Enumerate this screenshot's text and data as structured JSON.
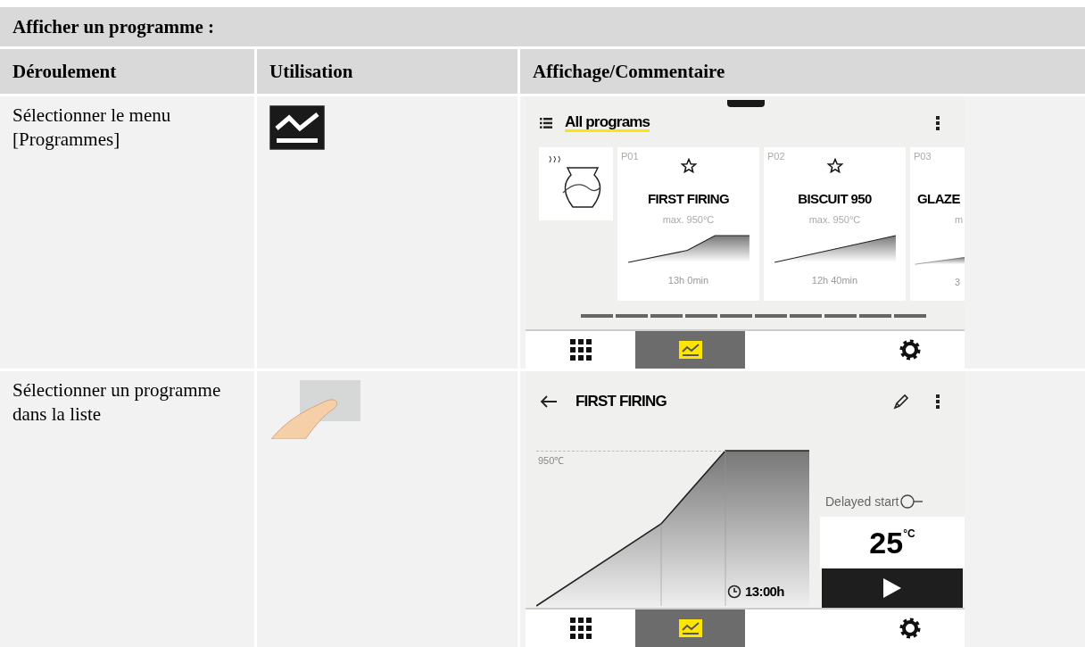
{
  "section_title": "Afficher un programme :",
  "columns": [
    "Déroulement",
    "Utilisation",
    "Affichage/Commentaire"
  ],
  "steps": [
    {
      "text": "Sélectionner le menu [Programmes]",
      "kind": "menu-icon",
      "screen": {
        "kind": "list",
        "title": "All programs",
        "cards": [
          {
            "code": "P01",
            "title": "FIRST FIRING",
            "max": "max. 950°C",
            "duration": "13h 0min"
          },
          {
            "code": "P02",
            "title": "BISCUIT 950",
            "max": "max. 950°C",
            "duration": "12h 40min"
          },
          {
            "code": "P03",
            "title": "GLAZE",
            "max": "m",
            "duration": "3"
          }
        ],
        "nav": [
          {
            "kind": "grid",
            "selected": false
          },
          {
            "kind": "chart",
            "selected": true
          },
          {
            "kind": "gear",
            "selected": false
          }
        ]
      }
    },
    {
      "text": "Sélectionner un programme dans la liste",
      "kind": "touch",
      "screen": {
        "kind": "detail",
        "title": "FIRST FIRING",
        "peak": "950℃",
        "duration": "13:00h",
        "delayed_label": "Delayed start",
        "delayed_on": false,
        "temperature": "25",
        "unit": "°C",
        "nav": [
          {
            "kind": "grid",
            "selected": false
          },
          {
            "kind": "chart",
            "selected": true
          },
          {
            "kind": "gear",
            "selected": false
          }
        ]
      }
    }
  ]
}
